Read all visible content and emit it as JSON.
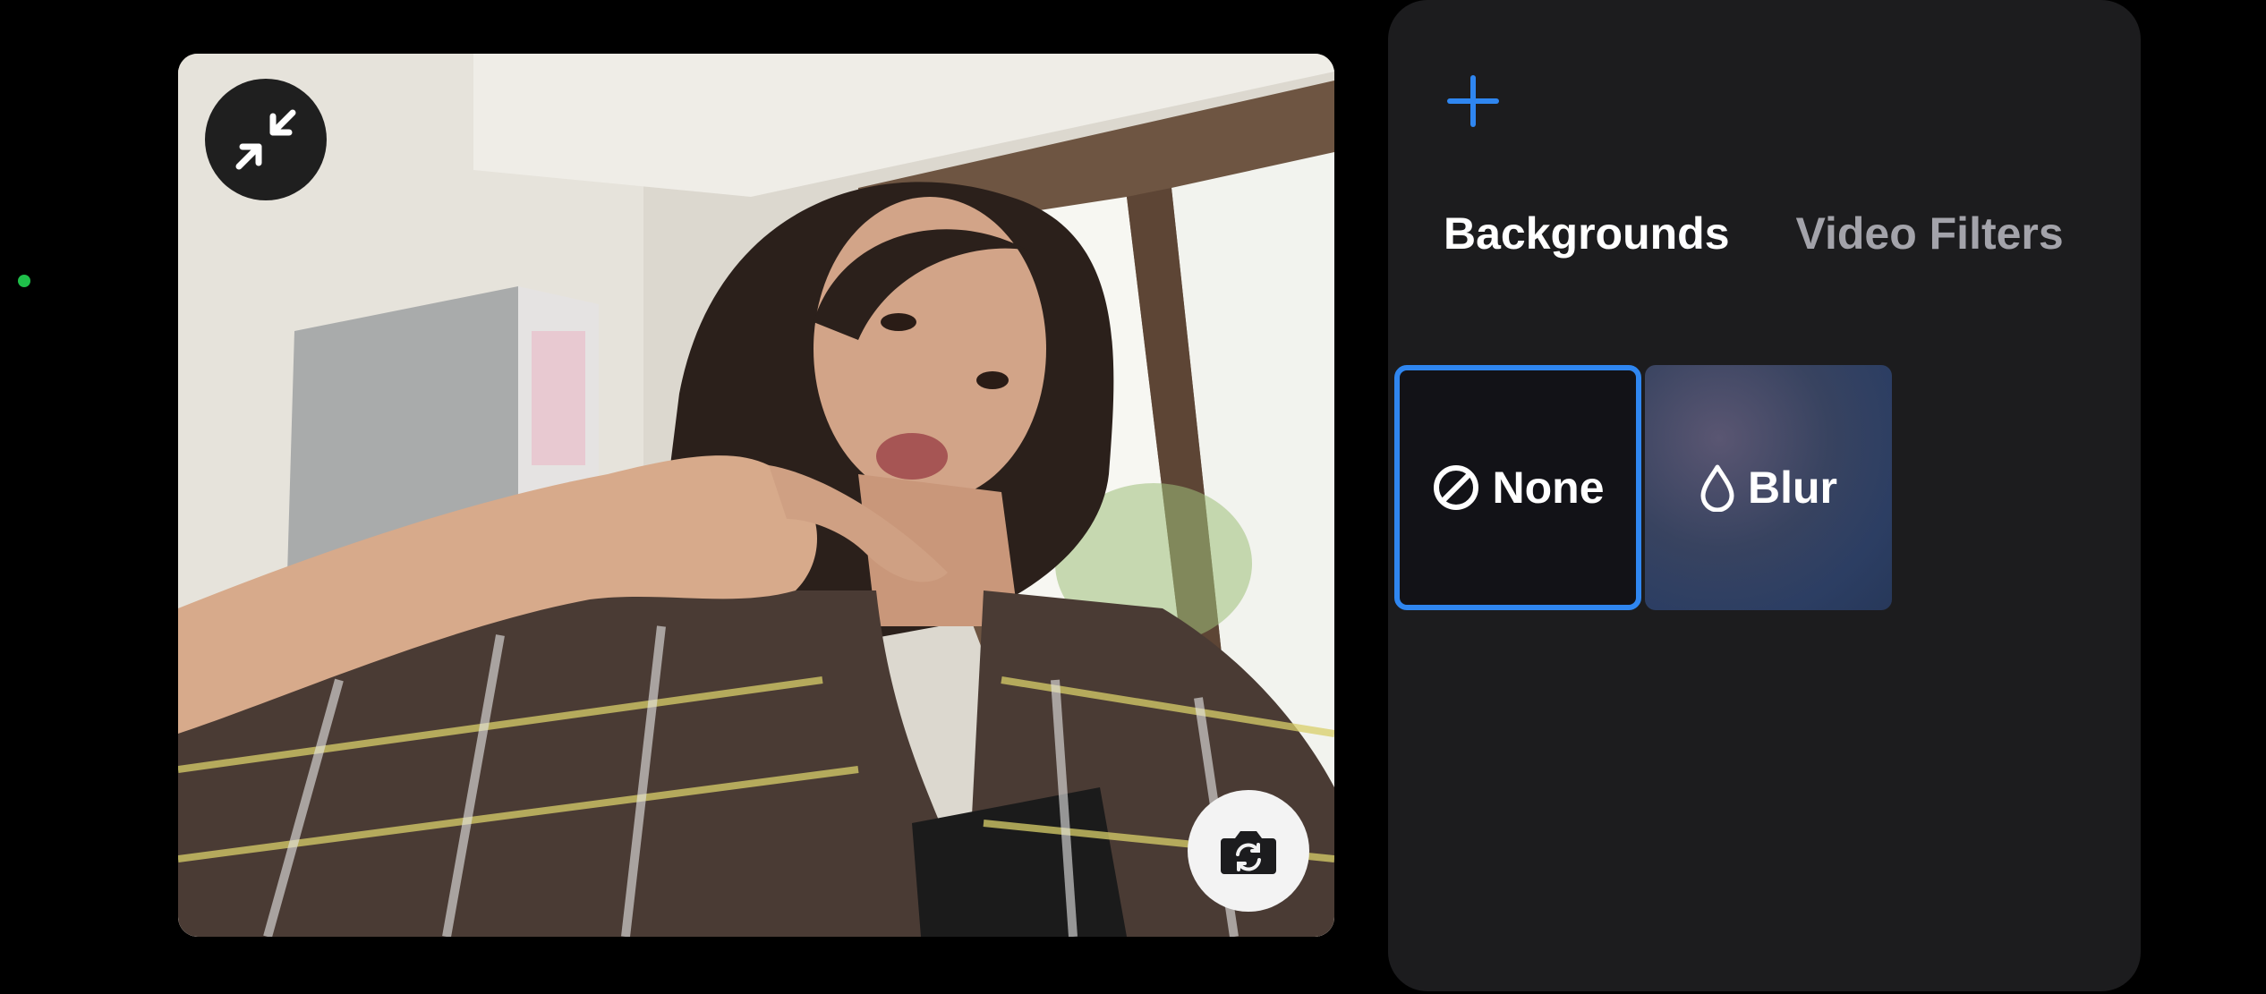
{
  "preview": {
    "collapse_icon": "collapse-arrows-icon",
    "flip_camera_icon": "camera-flip-icon"
  },
  "panel": {
    "add_icon": "plus-icon",
    "accent_color": "#2f86f0",
    "tabs": [
      {
        "label": "Backgrounds",
        "selected": true
      },
      {
        "label": "Video Filters",
        "selected": false
      }
    ],
    "backgrounds": [
      {
        "label": "None",
        "icon": "none-slash-icon",
        "selected": true
      },
      {
        "label": "Blur",
        "icon": "droplet-icon",
        "selected": false
      }
    ]
  }
}
